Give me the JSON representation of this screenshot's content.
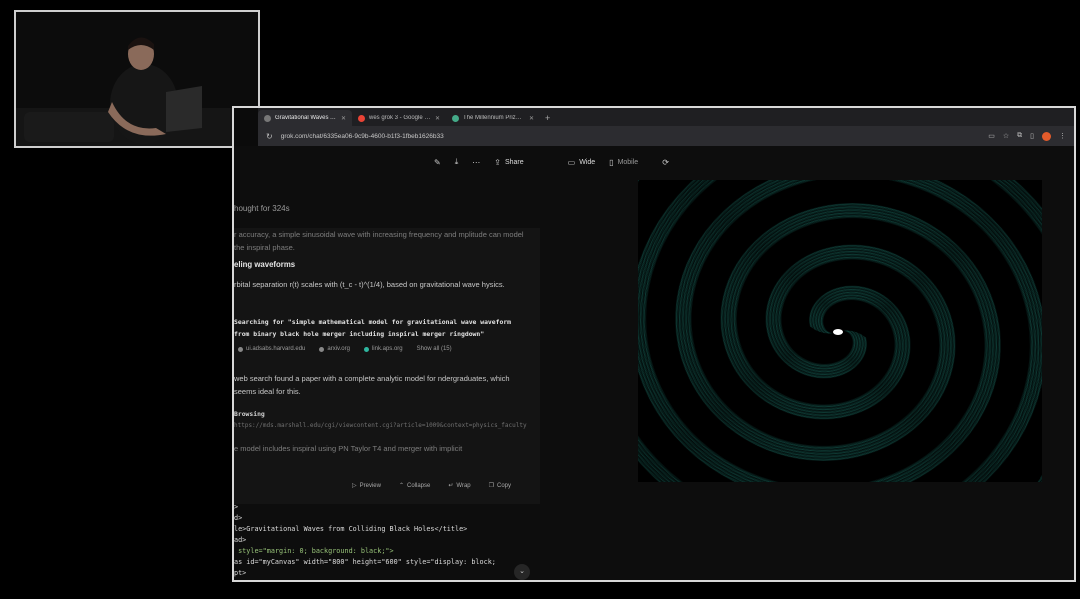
{
  "tabs": [
    {
      "label": "Gravitational Waves Animation",
      "active": true,
      "favicon": "grok-favicon"
    },
    {
      "label": "wes grok 3 - Google Search",
      "active": false,
      "favicon": "google-favicon"
    },
    {
      "label": "The Millennium Prize Problems",
      "active": false,
      "favicon": "page-favicon"
    }
  ],
  "address_bar": {
    "url": "grok.com/chat/6335ea06-9c9b-4600-b1f3-1fbeb1626b33"
  },
  "toolbar": {
    "share_label": "Share",
    "wide_label": "Wide",
    "mobile_label": "Mobile"
  },
  "chat": {
    "thought_label": "hought for 324s",
    "para1": "r accuracy, a simple sinusoidal wave with increasing frequency and mplitude can model the inspiral phase.",
    "heading1": "eling waveforms",
    "para2": "rbital separation r(t) scales with (t_c - t)^(1/4), based on gravitational wave hysics.",
    "search_text": "Searching for \"simple mathematical model for gravitational wave waveform from binary black hole merger including inspiral merger ringdown\"",
    "sources": [
      {
        "label": "ui.adsabs.harvard.edu",
        "icon": "globe-icon"
      },
      {
        "label": "arxiv.org",
        "icon": "arxiv-icon"
      },
      {
        "label": "link.aps.org",
        "icon": "aps-icon"
      },
      {
        "label": "Show all (15)",
        "icon": ""
      }
    ],
    "para3": "web search found a paper with a complete analytic model for ndergraduates, which seems ideal for this.",
    "browsing_title": "Browsing",
    "browsing_url": "https://mds.marshall.edu/cgi/viewcontent.cgi?article=1009&context=physics_faculty",
    "para4": "e model includes inspiral using PN Taylor T4 and merger with implicit"
  },
  "code_actions": {
    "preview": "Preview",
    "collapse": "Collapse",
    "wrap": "Wrap",
    "copy": "Copy"
  },
  "code_lines": [
    ">",
    "d>",
    "le>Gravitational Waves from Colliding Black Holes</title>",
    "ad>",
    " style=\"margin: 0; background: black;\">",
    "as id=\"myCanvas\" width=\"800\" height=\"600\" style=\"display: block;",
    "pt>"
  ],
  "colors": {
    "wave": "#2fb8a6",
    "background": "#000000",
    "frame": "#d8d8d8"
  }
}
